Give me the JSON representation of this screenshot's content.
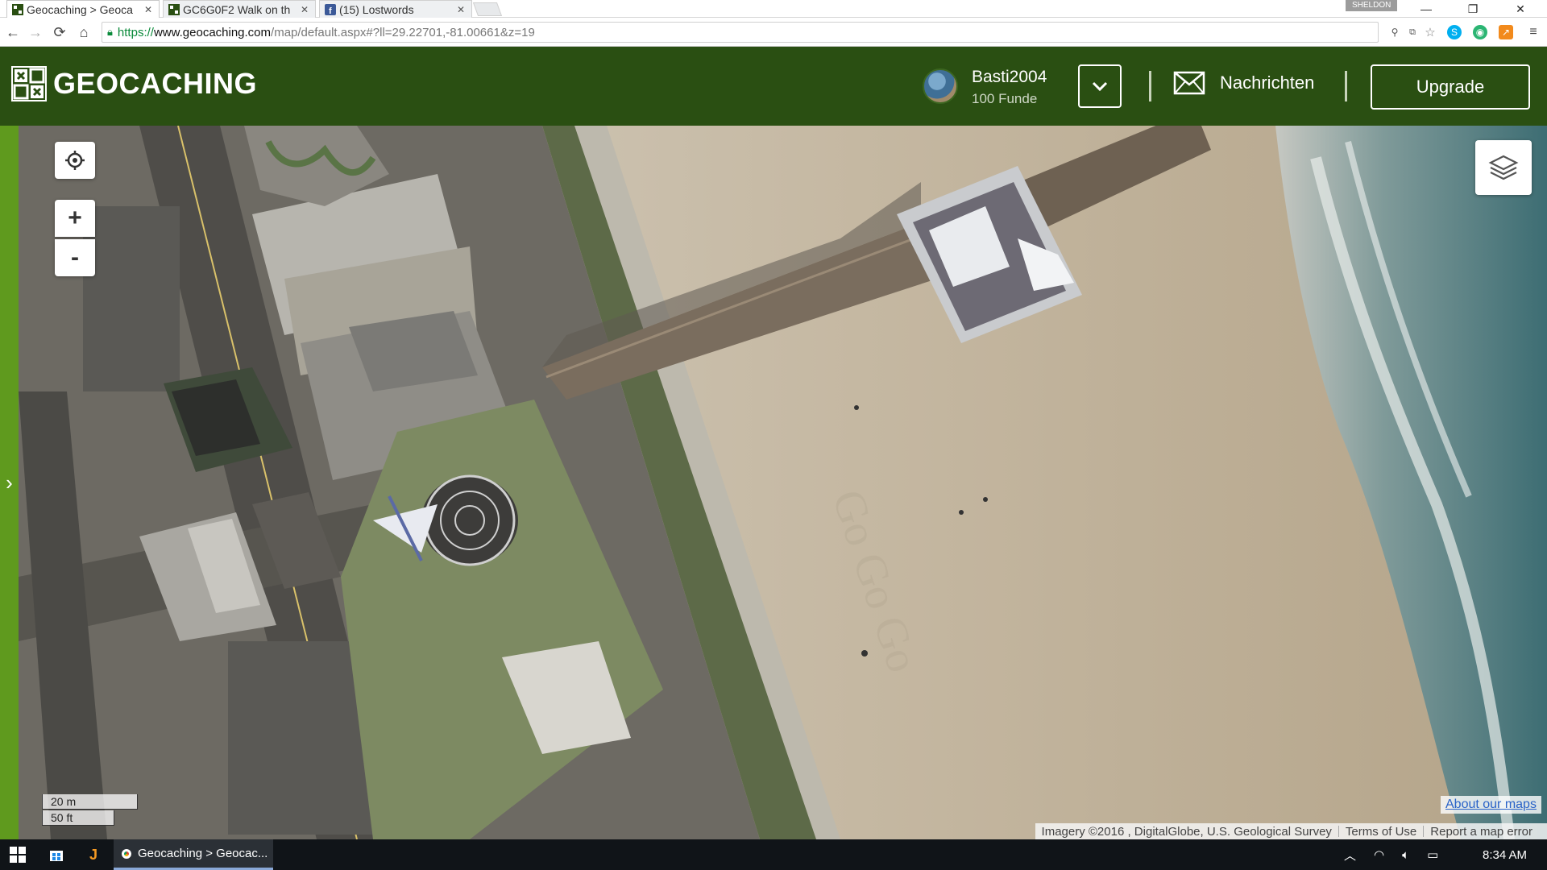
{
  "browser": {
    "tabs": [
      {
        "label": "Geocaching > Geoca",
        "icon": "geocaching-favicon",
        "active": true
      },
      {
        "label": "GC6G0F2 Walk on th",
        "icon": "geocaching-favicon",
        "active": false
      },
      {
        "label": "(15) Lostwords",
        "icon": "facebook-favicon",
        "active": false
      }
    ],
    "profile": "SHELDON",
    "url": {
      "scheme": "https://",
      "host": "www.geocaching.com",
      "path": "/map/default.aspx#?ll=29.22701,-81.00661&z=19"
    }
  },
  "header": {
    "logo_text": "GEOCACHING",
    "username": "Basti2004",
    "finds": "100 Funde",
    "messages_label": "Nachrichten",
    "upgrade_label": "Upgrade"
  },
  "map": {
    "zoom_in": "+",
    "zoom_out": "-",
    "scale_metric": "20 m",
    "scale_imperial": "50 ft",
    "about_maps": "About our maps",
    "attribution": "Imagery ©2016 , DigitalGlobe, U.S. Geological Survey",
    "terms": "Terms of Use",
    "report": "Report a map error",
    "google_mark": "Go"
  },
  "taskbar": {
    "chrome_window": "Geocaching > Geocac...",
    "clock": "8:34 AM"
  }
}
